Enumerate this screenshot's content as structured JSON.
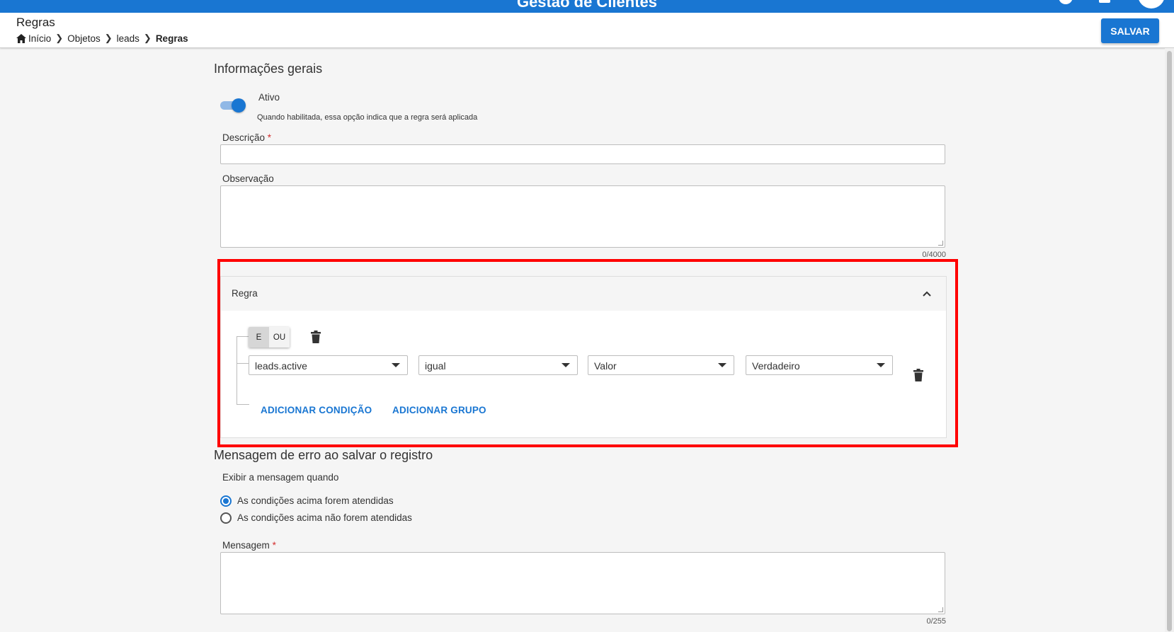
{
  "app": {
    "title": "Gestão de Clientes"
  },
  "header": {
    "page_title": "Regras",
    "breadcrumb": [
      "Início",
      "Objetos",
      "leads",
      "Regras"
    ],
    "save_label": "SALVAR"
  },
  "general": {
    "section_title": "Informações gerais",
    "active_label": "Ativo",
    "active_enabled": true,
    "active_hint": "Quando habilitada, essa opção indica que a regra será aplicada",
    "description_label": "Descrição",
    "description_value": "",
    "observation_label": "Observação",
    "observation_value": "",
    "observation_counter": "0/4000"
  },
  "rule": {
    "title": "Regra",
    "logic_and": "E",
    "logic_or": "OU",
    "logic_selected": "E",
    "condition": {
      "field": "leads.active",
      "operator": "igual",
      "type": "Valor",
      "value": "Verdadeiro"
    },
    "add_condition_label": "ADICIONAR CONDIÇÃO",
    "add_group_label": "ADICIONAR GRUPO",
    "highlight_color": "#ff0000"
  },
  "error_message": {
    "section_title": "Mensagem de erro ao salvar o registro",
    "show_when_label": "Exibir a mensagem quando",
    "options": [
      {
        "label": "As condições acima forem atendidas",
        "selected": true
      },
      {
        "label": "As condições acima não forem atendidas",
        "selected": false
      }
    ],
    "message_label": "Mensagem",
    "message_value": "",
    "message_counter": "0/255"
  },
  "colors": {
    "primary": "#1976d2",
    "required": "#d32f2f"
  }
}
